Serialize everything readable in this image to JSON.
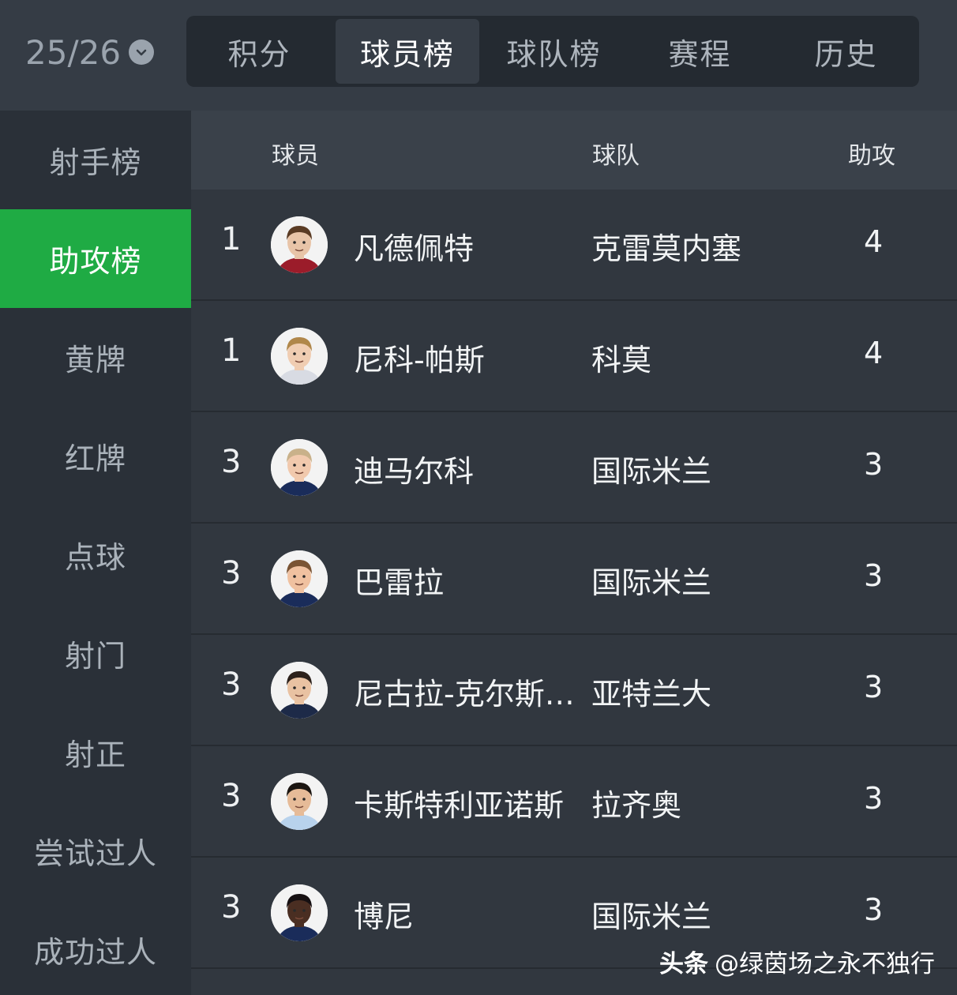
{
  "season": {
    "label": "25/26",
    "dropdown_icon": "chevron-down-icon"
  },
  "tabs": [
    {
      "label": "积分",
      "active": false
    },
    {
      "label": "球员榜",
      "active": true
    },
    {
      "label": "球队榜",
      "active": false
    },
    {
      "label": "赛程",
      "active": false
    },
    {
      "label": "历史",
      "active": false
    }
  ],
  "sidebar": {
    "items": [
      {
        "label": "射手榜",
        "active": false
      },
      {
        "label": "助攻榜",
        "active": true
      },
      {
        "label": "黄牌",
        "active": false
      },
      {
        "label": "红牌",
        "active": false
      },
      {
        "label": "点球",
        "active": false
      },
      {
        "label": "射门",
        "active": false
      },
      {
        "label": "射正",
        "active": false
      },
      {
        "label": "尝试过人",
        "active": false
      },
      {
        "label": "成功过人",
        "active": false
      }
    ],
    "active_color": "#1fab44"
  },
  "table": {
    "headers": {
      "player": "球员",
      "team": "球队",
      "stat": "助攻"
    },
    "rows": [
      {
        "rank": "1",
        "player": "凡德佩特",
        "team": "克雷莫内塞",
        "assists": "4",
        "hair": "#5a3b24",
        "skin": "#e8c4a8",
        "shirt": "#9b1c2a"
      },
      {
        "rank": "1",
        "player": "尼科-帕斯",
        "team": "科莫",
        "assists": "4",
        "hair": "#b0874a",
        "skin": "#f0cdb2",
        "shirt": "#d8dbe3"
      },
      {
        "rank": "3",
        "player": "迪马尔科",
        "team": "国际米兰",
        "assists": "3",
        "hair": "#c9b18a",
        "skin": "#f1c9ad",
        "shirt": "#1a2c5a"
      },
      {
        "rank": "3",
        "player": "巴雷拉",
        "team": "国际米兰",
        "assists": "3",
        "hair": "#7a5434",
        "skin": "#f0c1a0",
        "shirt": "#1a2c5a"
      },
      {
        "rank": "3",
        "player": "尼古拉-克尔斯托维奇",
        "team": "亚特兰大",
        "assists": "3",
        "hair": "#2c211b",
        "skin": "#e9c2a2",
        "shirt": "#1d2a48"
      },
      {
        "rank": "3",
        "player": "卡斯特利亚诺斯",
        "team": "拉齐奥",
        "assists": "3",
        "hair": "#1c1612",
        "skin": "#e6bb98",
        "shirt": "#b8d2ec"
      },
      {
        "rank": "3",
        "player": "博尼",
        "team": "国际米兰",
        "assists": "3",
        "hair": "#161012",
        "skin": "#4a2e22",
        "shirt": "#1a2c5a"
      }
    ]
  },
  "credit": {
    "brand": "头条",
    "text": "@绿茵场之永不独行"
  }
}
